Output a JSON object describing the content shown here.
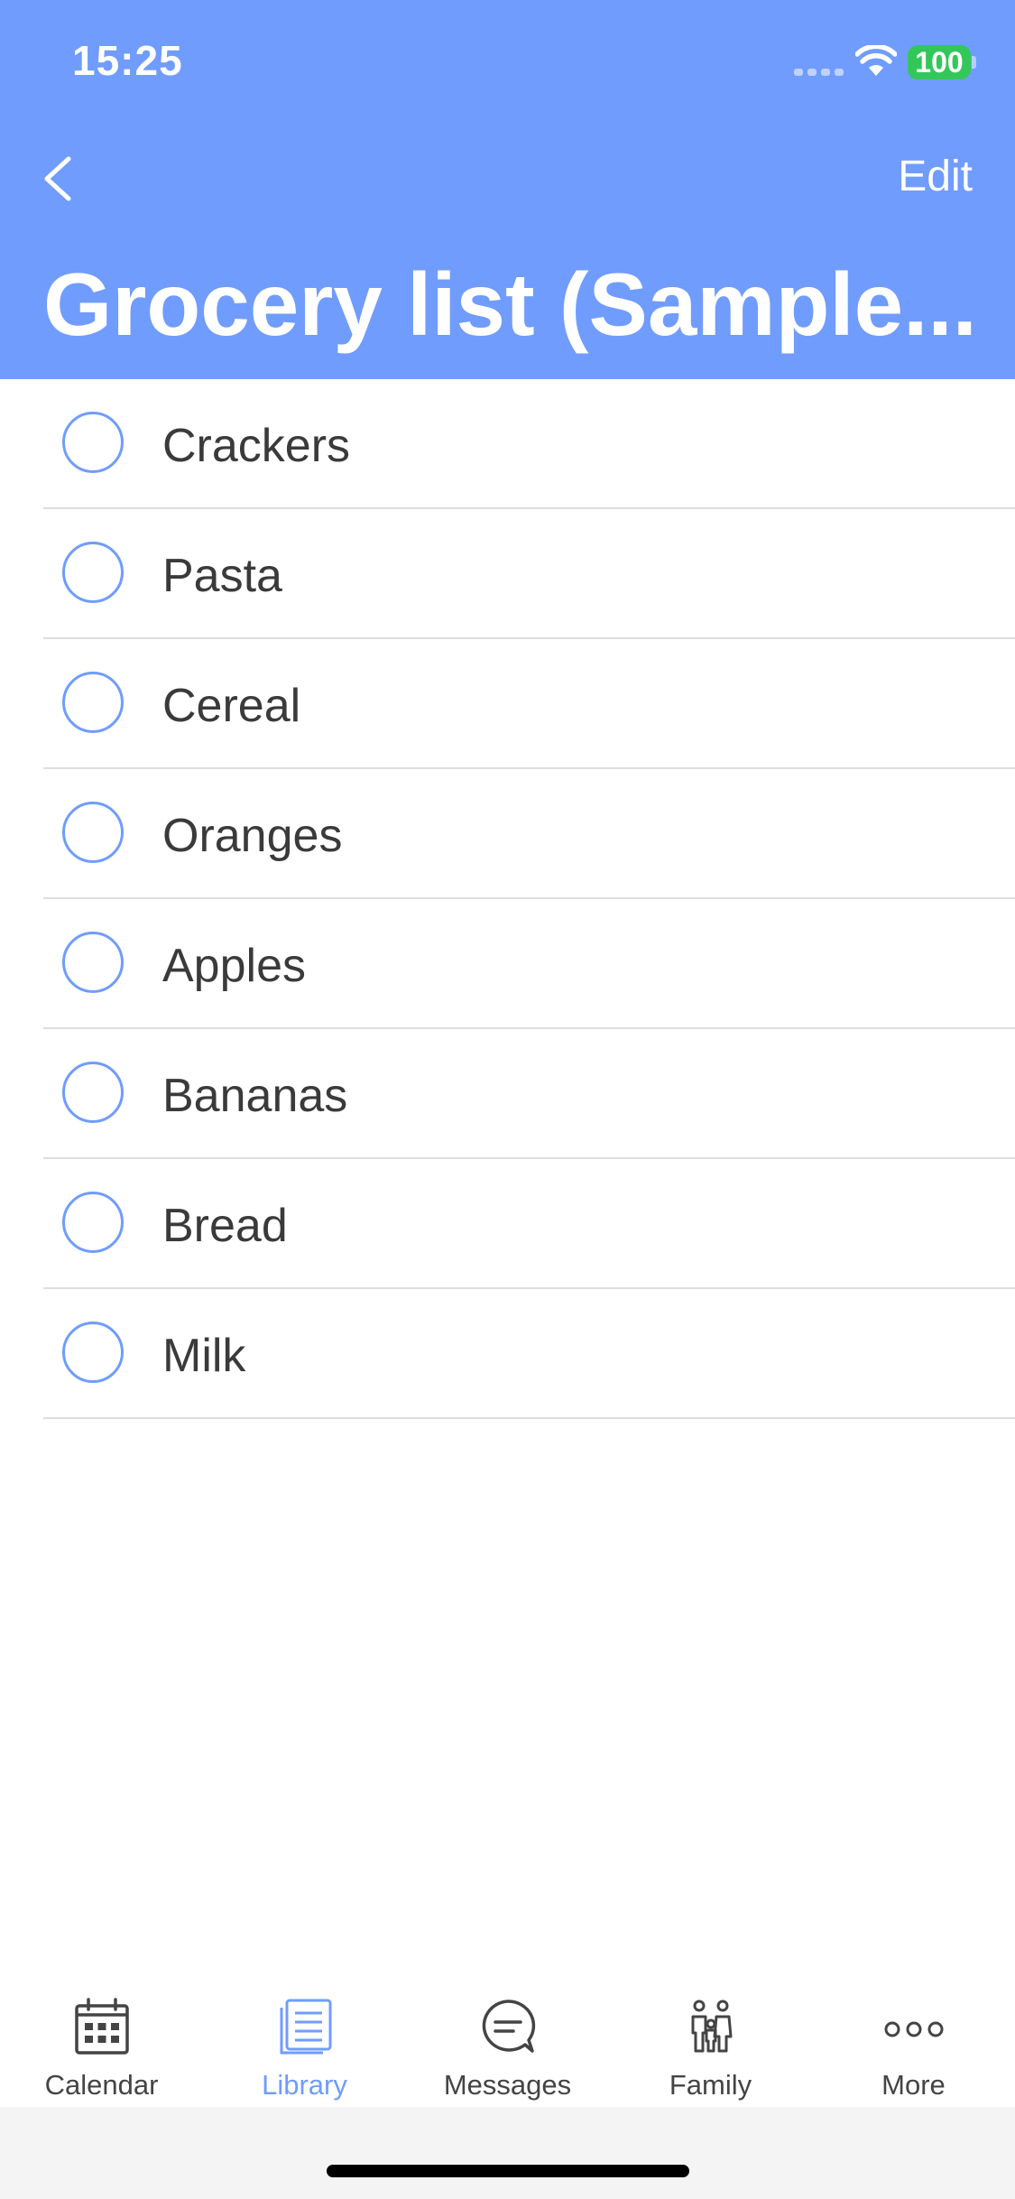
{
  "status_bar": {
    "time": "15:25",
    "battery": "100"
  },
  "nav": {
    "back_icon": "chevron-left-icon",
    "edit_label": "Edit",
    "title": "Grocery list (Sample..."
  },
  "list": {
    "items": [
      {
        "label": "Crackers"
      },
      {
        "label": "Pasta"
      },
      {
        "label": "Cereal"
      },
      {
        "label": "Oranges"
      },
      {
        "label": "Apples"
      },
      {
        "label": "Bananas"
      },
      {
        "label": "Bread"
      },
      {
        "label": "Milk"
      }
    ]
  },
  "tabbar": {
    "tabs": [
      {
        "label": "Calendar",
        "icon": "calendar-icon"
      },
      {
        "label": "Library",
        "icon": "library-icon",
        "active": true
      },
      {
        "label": "Messages",
        "icon": "messages-icon"
      },
      {
        "label": "Family",
        "icon": "family-icon"
      },
      {
        "label": "More",
        "icon": "more-icon"
      }
    ]
  },
  "colors": {
    "accent": "#709cfd",
    "battery": "#33c759",
    "text": "#3a3a3a"
  }
}
